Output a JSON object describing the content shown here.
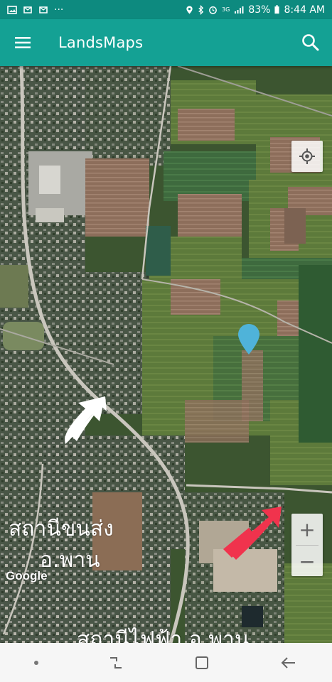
{
  "status_bar": {
    "battery": "83%",
    "time": "8:44 AM",
    "network": "3G",
    "more": "···",
    "bg_color": "#0d8a7f"
  },
  "app_bar": {
    "title": "LandsMaps",
    "bg_color": "#14a194"
  },
  "map": {
    "attribution": "Google",
    "zoom_in_label": "+",
    "zoom_out_label": "−",
    "annotations": {
      "line1": "สถานีขนส่ง",
      "line2": "อ.พาน",
      "line3": "สถานีไฟฟ้า อ.พาน"
    },
    "pin_color": "#4fb3d9",
    "arrow_white": "#ffffff",
    "arrow_red": "#f0334d"
  },
  "nav_bar": {
    "icons": [
      "recent-apps-icon",
      "overview-icon",
      "back-icon"
    ]
  }
}
